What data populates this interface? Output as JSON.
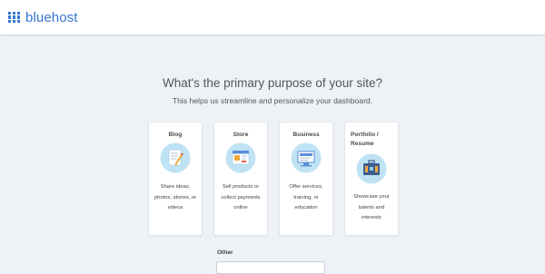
{
  "header": {
    "logo_text": "bluehost"
  },
  "main": {
    "headline": "What's the primary purpose of your site?",
    "subline": "This helps us streamline and personalize your dashboard.",
    "cards": [
      {
        "title": "Blog",
        "description": "Share ideas, photos, stories, or videos",
        "icon": "blog-icon"
      },
      {
        "title": "Store",
        "description": "Sell products or collect payments online",
        "icon": "store-icon"
      },
      {
        "title": "Business",
        "description": "Offer services, training, or education",
        "icon": "business-icon"
      },
      {
        "title": "Portfolio / Resume",
        "description": "Showcase your talents and interests",
        "icon": "portfolio-icon"
      }
    ],
    "other": {
      "label": "Other",
      "value": ""
    }
  },
  "colors": {
    "brand": "#3575d3",
    "icon_circle": "#bfe3f4",
    "background": "#eef2f7"
  }
}
